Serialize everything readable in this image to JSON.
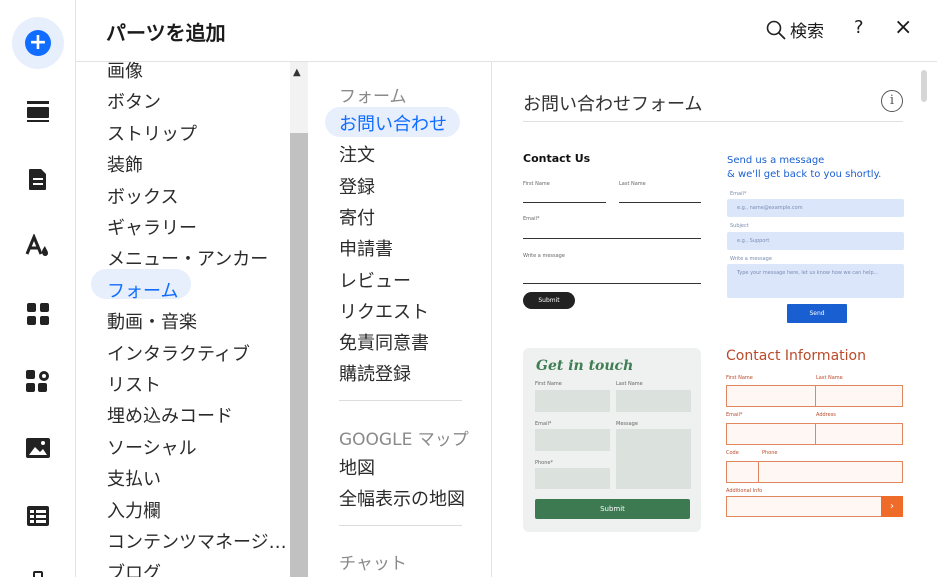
{
  "header": {
    "title": "パーツを追加",
    "search_label": "検索",
    "help_label": "?",
    "close_label": "×"
  },
  "rail": {
    "icons": [
      "add-icon",
      "sections-icon",
      "pages-icon",
      "design-icon",
      "apps-icon",
      "business-icon",
      "media-icon",
      "cms-icon",
      "portfolio-icon"
    ]
  },
  "categories": [
    "画像",
    "ボタン",
    "ストリップ",
    "装飾",
    "ボックス",
    "ギャラリー",
    "メニュー・アンカー",
    "フォーム",
    "動画・音楽",
    "インタラクティブ",
    "リスト",
    "埋め込みコード",
    "ソーシャル",
    "支払い",
    "入力欄",
    "コンテンツマネージ…",
    "ブログ"
  ],
  "active_category": "フォーム",
  "subcategories": {
    "forms_heading": "フォーム",
    "forms_items": [
      "お問い合わせ",
      "注文",
      "登録",
      "寄付",
      "申請書",
      "レビュー",
      "リクエスト",
      "免責同意書",
      "購読登録"
    ],
    "active_item": "お問い合わせ",
    "maps_heading": "GOOGLE マップ",
    "maps_items": [
      "地図",
      "全幅表示の地図"
    ],
    "chat_heading": "チャット"
  },
  "preview": {
    "title": "お問い合わせフォーム",
    "info_label": "i",
    "card1": {
      "title": "Contact Us",
      "first_name": "First Name",
      "last_name": "Last Name",
      "email": "Email*",
      "message": "Write a message",
      "submit": "Submit"
    },
    "card2": {
      "heading_line1": "Send us a message",
      "heading_line2": "& we'll get back to you shortly.",
      "email_label": "Email*",
      "email_placeholder": "e.g., name@example.com",
      "subject_label": "Subject",
      "subject_placeholder": "e.g., Support",
      "message_label": "Write a message",
      "message_placeholder": "Type your message here, let us know how we can help...",
      "send": "Send"
    },
    "card3": {
      "title": "Get in touch",
      "first_name": "First Name",
      "last_name": "Last Name",
      "email": "Email*",
      "message": "Message",
      "phone": "Phone*",
      "submit": "Submit"
    },
    "card4": {
      "title": "Contact Information",
      "first_name": "First Name",
      "last_name": "Last Name",
      "email": "Email*",
      "address": "Address",
      "code": "Code",
      "phone": "Phone",
      "additional_info": "Additional Info",
      "go": "›"
    }
  },
  "colors": {
    "accent": "#116dff",
    "accent_soft": "#e7effd",
    "text": "#1b1b1b"
  }
}
